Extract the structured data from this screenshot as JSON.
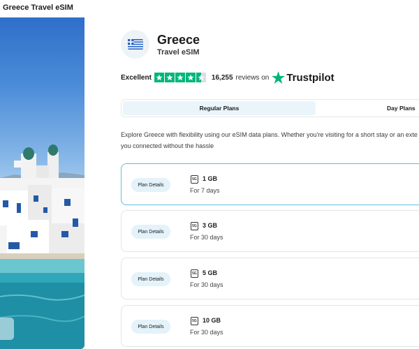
{
  "hero": {
    "caption": "Greece Travel eSIM"
  },
  "product": {
    "country": "Greece",
    "subtitle": "Travel eSIM",
    "flag_icon": "greece-flag-icon"
  },
  "rating": {
    "label": "Excellent",
    "stars": 4.5,
    "count": "16,255",
    "reviews_text": "reviews on",
    "platform": "Trustpilot",
    "star_color": "#00b67a"
  },
  "tabs": [
    {
      "label": "Regular Plans",
      "active": true
    },
    {
      "label": "Day Plans",
      "active": false
    }
  ],
  "description": {
    "line1": "Explore Greece with flexibility using our eSIM data plans. Whether you're visiting for a short stay or an exte",
    "line2": "you connected without the hassle"
  },
  "plans": [
    {
      "button": "Plan Details",
      "icon_label": "5G",
      "size": "1 GB",
      "duration": "For 7 days",
      "selected": true
    },
    {
      "button": "Plan Details",
      "icon_label": "5G",
      "size": "3 GB",
      "duration": "For 30 days",
      "selected": false
    },
    {
      "button": "Plan Details",
      "icon_label": "5G",
      "size": "5 GB",
      "duration": "For 30 days",
      "selected": false
    },
    {
      "button": "Plan Details",
      "icon_label": "5G",
      "size": "10 GB",
      "duration": "For 30 days",
      "selected": false
    }
  ],
  "colors": {
    "accent_border": "#5fbfdc",
    "pill_bg": "#e4f2fa",
    "active_tab_bg": "#e9f5fb"
  }
}
